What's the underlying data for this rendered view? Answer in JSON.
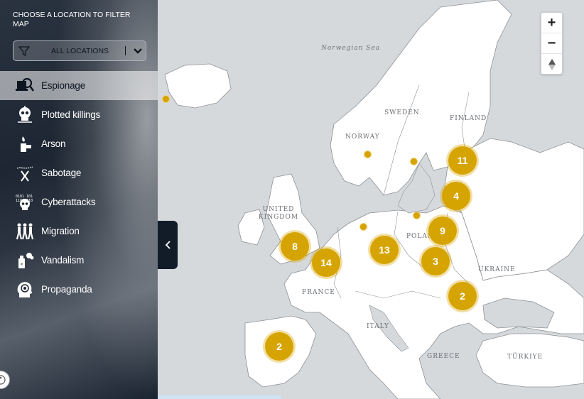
{
  "sidebar": {
    "filter_title": "CHOOSE A LOCATION TO FILTER MAP",
    "select_value": "ALL LOCATIONS",
    "categories": [
      {
        "label": "Espionage",
        "icon": "spy-laptop-icon",
        "active": true
      },
      {
        "label": "Plotted killings",
        "icon": "skull-crosshair-icon",
        "active": false
      },
      {
        "label": "Arson",
        "icon": "lighter-flame-icon",
        "active": false
      },
      {
        "label": "Sabotage",
        "icon": "pliers-wire-icon",
        "active": false
      },
      {
        "label": "Cyberattacks",
        "icon": "binary-skull-icon",
        "active": false
      },
      {
        "label": "Migration",
        "icon": "walking-people-icon",
        "active": false
      },
      {
        "label": "Vandalism",
        "icon": "spray-can-icon",
        "active": false
      },
      {
        "label": "Propaganda",
        "icon": "head-target-icon",
        "active": false
      }
    ]
  },
  "map": {
    "sea_labels": [
      {
        "text": "Norwegian Sea"
      }
    ],
    "country_labels": [
      "SWEDEN",
      "FINLAND",
      "NORWAY",
      "UNITED KINGDOM",
      "POLAND",
      "UKRAINE",
      "FRANCE",
      "ITALY",
      "GREECE",
      "TÜRKIYE"
    ],
    "clusters": [
      11,
      4,
      9,
      8,
      14,
      13,
      3,
      2,
      2
    ],
    "marker_color": "#d6a400",
    "single_points": 6
  },
  "zoom": {
    "in": "+",
    "out": "−",
    "north": "▲"
  }
}
